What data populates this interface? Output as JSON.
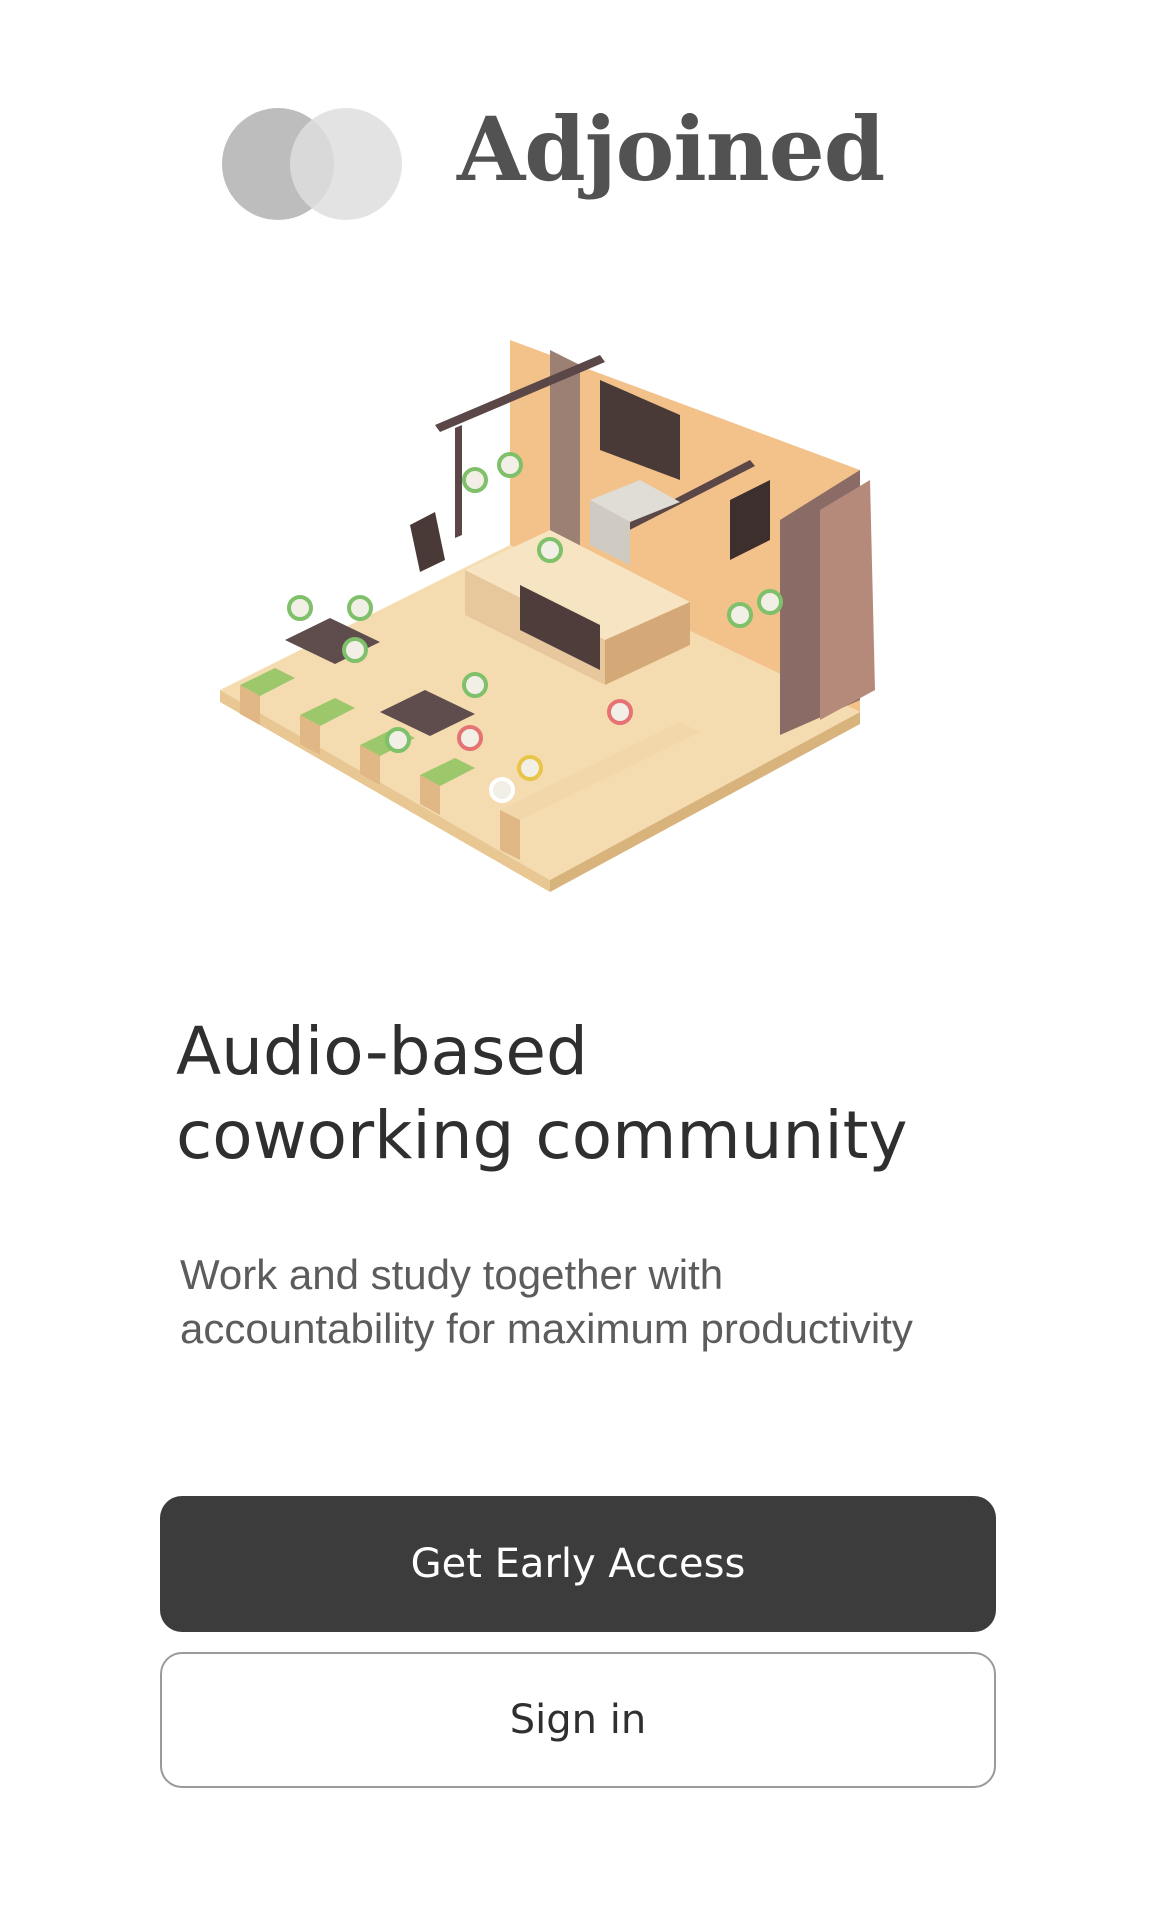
{
  "brand": {
    "name": "Adjoined",
    "logo_colors": [
      "#bdbdbd",
      "#dedede"
    ],
    "text_color": "#525252"
  },
  "hero": {
    "illustration": "isometric-coffee-shop-illustration",
    "headline_line1": "Audio-based",
    "headline_line2": "coworking community",
    "subtitle_line1": "Work and study together with",
    "subtitle_line2": "accountability for maximum productivity"
  },
  "actions": {
    "primary_label": "Get Early Access",
    "secondary_label": "Sign in",
    "primary_color": "#3c3c3c"
  }
}
